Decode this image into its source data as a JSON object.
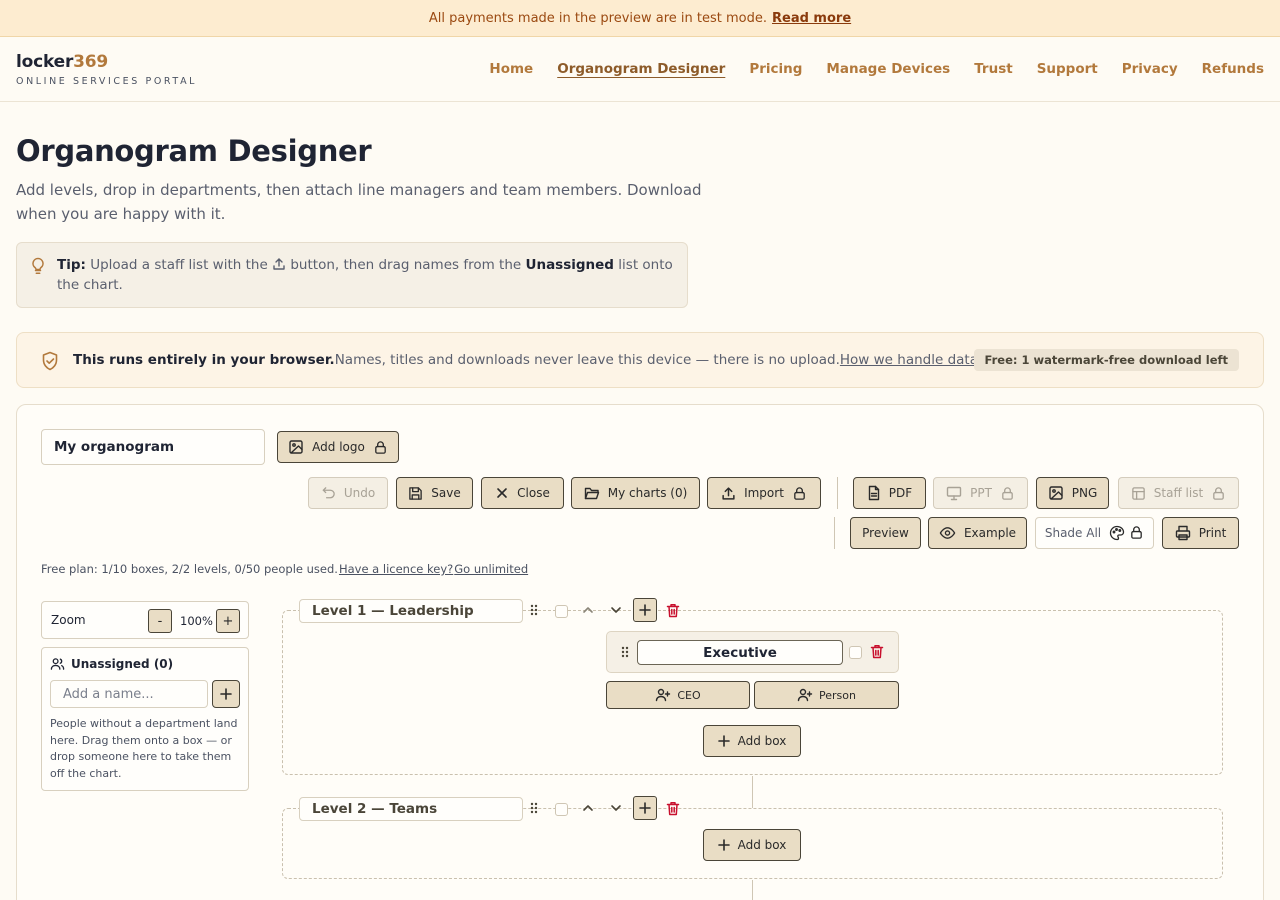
{
  "banner": {
    "text": "All payments made in the preview are in test mode.",
    "link": "Read more"
  },
  "header": {
    "logo_main": "locker",
    "logo_accent": "369",
    "logo_sub": "ONLINE SERVICES PORTAL",
    "nav": [
      "Home",
      "Organogram Designer",
      "Pricing",
      "Manage Devices",
      "Trust",
      "Support",
      "Privacy",
      "Refunds"
    ],
    "active_nav": "Organogram Designer"
  },
  "intro": {
    "title": "Organogram Designer",
    "description": "Add levels, drop in departments, then attach line managers and team members. Download when you are happy with it.",
    "tip_label": "Tip:",
    "tip_before": "Upload a staff list with the",
    "tip_middle": "button, then drag names from the",
    "tip_bold": "Unassigned",
    "tip_after": "list onto the chart."
  },
  "privacy": {
    "bold": "This runs entirely in your browser.",
    "text": "Names, titles and downloads never leave this device — there is no upload.",
    "link": "How we handle data",
    "badge": "Free: 1 watermark-free download left"
  },
  "designer": {
    "chart_name": "My organogram",
    "toolbar": {
      "add_logo": "Add logo",
      "undo": "Undo",
      "save": "Save",
      "close": "Close",
      "my_charts": "My charts (0)",
      "import": "Import",
      "pdf": "PDF",
      "ppt": "PPT",
      "png": "PNG",
      "staff_list": "Staff list",
      "preview": "Preview",
      "example": "Example",
      "shade_all": "Shade All",
      "print": "Print"
    },
    "plan": {
      "text": "Free plan: 1/10 boxes, 2/2 levels, 0/50 people used.",
      "licence_link": "Have a licence key?",
      "unlimited_link": "Go unlimited"
    },
    "zoom": {
      "label": "Zoom",
      "minus": "-",
      "value": "100%",
      "plus": "+"
    },
    "unassigned": {
      "title": "Unassigned (0)",
      "placeholder": "Add a name...",
      "help": "People without a department land here. Drag them onto a box — or drop someone here to take them off the chart."
    },
    "levels": [
      {
        "name": "Level 1 — Leadership",
        "boxes": [
          {
            "name": "Executive",
            "ceo_label": "CEO",
            "person_label": "Person"
          }
        ],
        "add_box": "Add box"
      },
      {
        "name": "Level 2 — Teams",
        "boxes": [],
        "add_box": "Add box"
      }
    ]
  },
  "colors": {
    "accent": "#b2793c",
    "button_fill": "#e9ddc5",
    "banner_bg": "#fdecd0",
    "delete_red": "#c8102e"
  }
}
